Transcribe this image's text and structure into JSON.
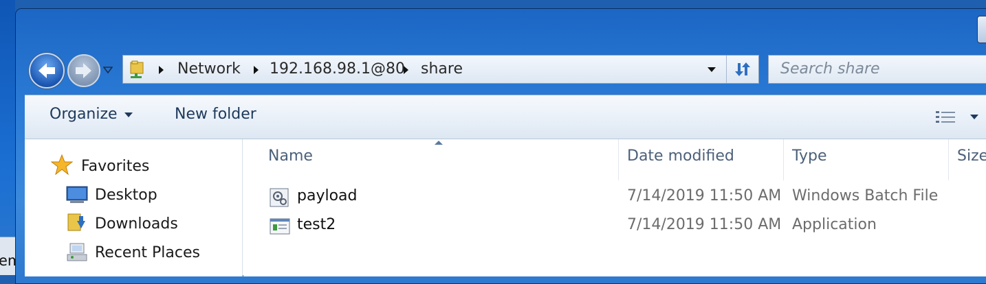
{
  "background_window": {
    "text": "em"
  },
  "navigation": {
    "back_icon": "back-arrow-icon",
    "forward_icon": "forward-arrow-icon"
  },
  "address_bar": {
    "breadcrumbs": [
      "Network",
      "192.168.98.1@80",
      "share"
    ],
    "refresh_icon": "refresh-icon"
  },
  "search": {
    "placeholder": "Search share"
  },
  "toolbar": {
    "organize_label": "Organize",
    "new_folder_label": "New folder",
    "views_icon": "change-view-icon"
  },
  "sidebar": {
    "items": [
      {
        "label": "Favorites",
        "icon": "star-icon"
      },
      {
        "label": "Desktop",
        "icon": "desktop-icon"
      },
      {
        "label": "Downloads",
        "icon": "downloads-folder-icon"
      },
      {
        "label": "Recent Places",
        "icon": "recent-places-icon"
      }
    ]
  },
  "file_list": {
    "columns": [
      "Name",
      "Date modified",
      "Type",
      "Size"
    ],
    "sort_column": "Name",
    "rows": [
      {
        "name": "payload",
        "date": "7/14/2019 11:50 AM",
        "type": "Windows Batch File",
        "icon": "batch-file-icon"
      },
      {
        "name": "test2",
        "date": "7/14/2019 11:50 AM",
        "type": "Application",
        "icon": "application-icon"
      }
    ]
  },
  "colors": {
    "titlebar": "#2a7bd6",
    "toolbar_text": "#1e395b",
    "column_header_text": "#4c607a",
    "secondary_text": "#6c6c6c"
  }
}
